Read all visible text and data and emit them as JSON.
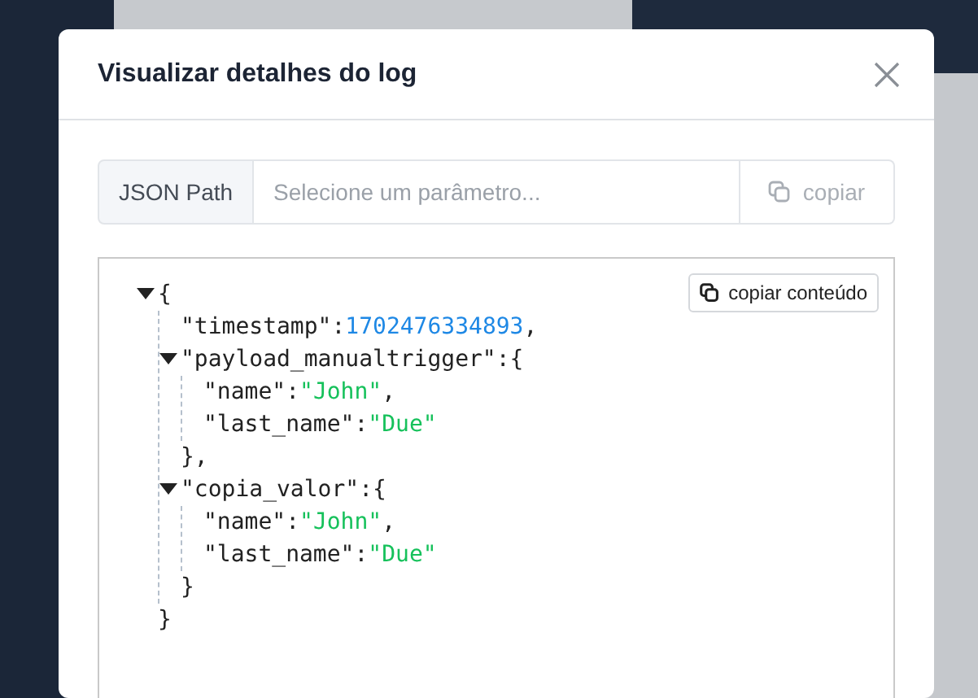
{
  "dialog": {
    "title": "Visualizar detalhes do log"
  },
  "path_bar": {
    "addon": "JSON Path",
    "placeholder": "Selecione um parâmetro...",
    "copy_button": {
      "label": "copiar",
      "disabled": true
    }
  },
  "viewer": {
    "copy_button": "copiar conteúdo",
    "tree": {
      "kind": "object",
      "expanded": true,
      "open": "{",
      "close": "}",
      "children": [
        {
          "kind": "number",
          "key": "\"timestamp\":",
          "value": "1702476334893",
          "suffix": ","
        },
        {
          "kind": "object",
          "expanded": true,
          "open": "\"payload_manualtrigger\":{",
          "close": "},",
          "children": [
            {
              "kind": "string",
              "key": "\"name\":",
              "value": "\"John\"",
              "suffix": ","
            },
            {
              "kind": "string",
              "key": "\"last_name\":",
              "value": "\"Due\""
            }
          ]
        },
        {
          "kind": "object",
          "expanded": true,
          "open": "\"copia_valor\":{",
          "close": "}",
          "children": [
            {
              "kind": "string",
              "key": "\"name\":",
              "value": "\"John\"",
              "suffix": ","
            },
            {
              "kind": "string",
              "key": "\"last_name\":",
              "value": "\"Due\""
            }
          ]
        }
      ]
    }
  }
}
